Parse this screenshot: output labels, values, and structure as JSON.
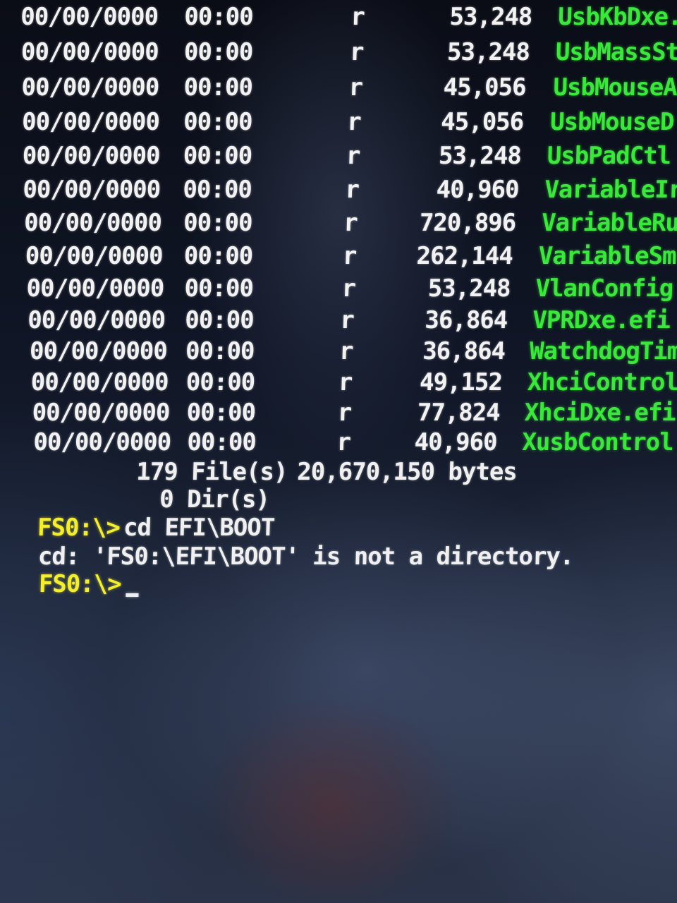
{
  "colors": {
    "text_white": "#f0f0f0",
    "filename_green": "#39e83a",
    "prompt_yellow": "#f4ef2a"
  },
  "listing": [
    {
      "date": "00/00/0000",
      "time": "00:00",
      "attr": "r",
      "size": "53,248",
      "name": "UsbKbDxe."
    },
    {
      "date": "00/00/0000",
      "time": "00:00",
      "attr": "r",
      "size": "53,248",
      "name": "UsbMassSt"
    },
    {
      "date": "00/00/0000",
      "time": "00:00",
      "attr": "r",
      "size": "45,056",
      "name": "UsbMouseA"
    },
    {
      "date": "00/00/0000",
      "time": "00:00",
      "attr": "r",
      "size": "45,056",
      "name": "UsbMouseD"
    },
    {
      "date": "00/00/0000",
      "time": "00:00",
      "attr": "r",
      "size": "53,248",
      "name": "UsbPadCtl"
    },
    {
      "date": "00/00/0000",
      "time": "00:00",
      "attr": "r",
      "size": "40,960",
      "name": "VariableIr"
    },
    {
      "date": "00/00/0000",
      "time": "00:00",
      "attr": "r",
      "size": "720,896",
      "name": "VariableRu"
    },
    {
      "date": "00/00/0000",
      "time": "00:00",
      "attr": "r",
      "size": "262,144",
      "name": "VariableSm"
    },
    {
      "date": "00/00/0000",
      "time": "00:00",
      "attr": "r",
      "size": "53,248",
      "name": "VlanConfig"
    },
    {
      "date": "00/00/0000",
      "time": "00:00",
      "attr": "r",
      "size": "36,864",
      "name": "VPRDxe.efi"
    },
    {
      "date": "00/00/0000",
      "time": "00:00",
      "attr": "r",
      "size": "36,864",
      "name": "WatchdogTim"
    },
    {
      "date": "00/00/0000",
      "time": "00:00",
      "attr": "r",
      "size": "49,152",
      "name": "XhciControl"
    },
    {
      "date": "00/00/0000",
      "time": "00:00",
      "attr": "r",
      "size": "77,824",
      "name": "XhciDxe.efi"
    },
    {
      "date": "00/00/0000",
      "time": "00:00",
      "attr": "r",
      "size": "40,960",
      "name": "XusbControl"
    }
  ],
  "summary": {
    "files": "179 File(s)",
    "bytes": "20,670,150 bytes",
    "dirs": "0 Dir(s)"
  },
  "session": {
    "prompt": "FS0:\\>",
    "command": "cd EFI\\BOOT",
    "error": "cd: 'FS0:\\EFI\\BOOT' is not a directory.",
    "prompt2": "FS0:\\>"
  }
}
